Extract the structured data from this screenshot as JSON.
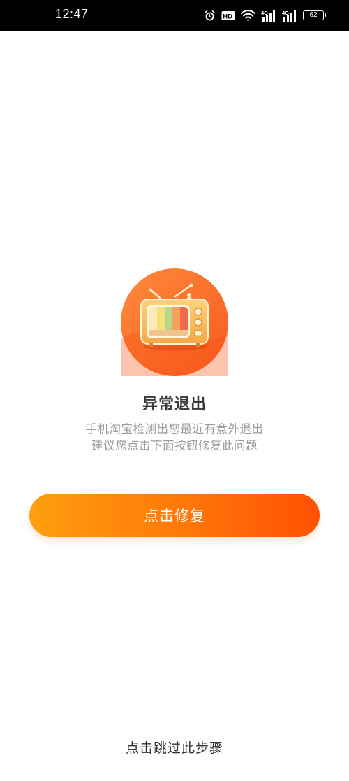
{
  "status_bar": {
    "time": "12:47",
    "battery": "62",
    "icons": [
      "alarm-icon",
      "hd-icon",
      "wifi-icon",
      "signal-4g-icon",
      "signal-4g-icon",
      "battery-icon"
    ]
  },
  "main": {
    "title": "异常退出",
    "description_line1": "手机淘宝检测出您最近有意外退出",
    "description_line2": "建议您点击下面按钮修复此问题",
    "repair_button_label": "点击修复",
    "skip_label": "点击跳过此步骤"
  },
  "colors": {
    "accent_start": "#ff9f0f",
    "accent_end": "#ff5003",
    "title": "#3a3a3a",
    "description": "#9a9a9a"
  }
}
